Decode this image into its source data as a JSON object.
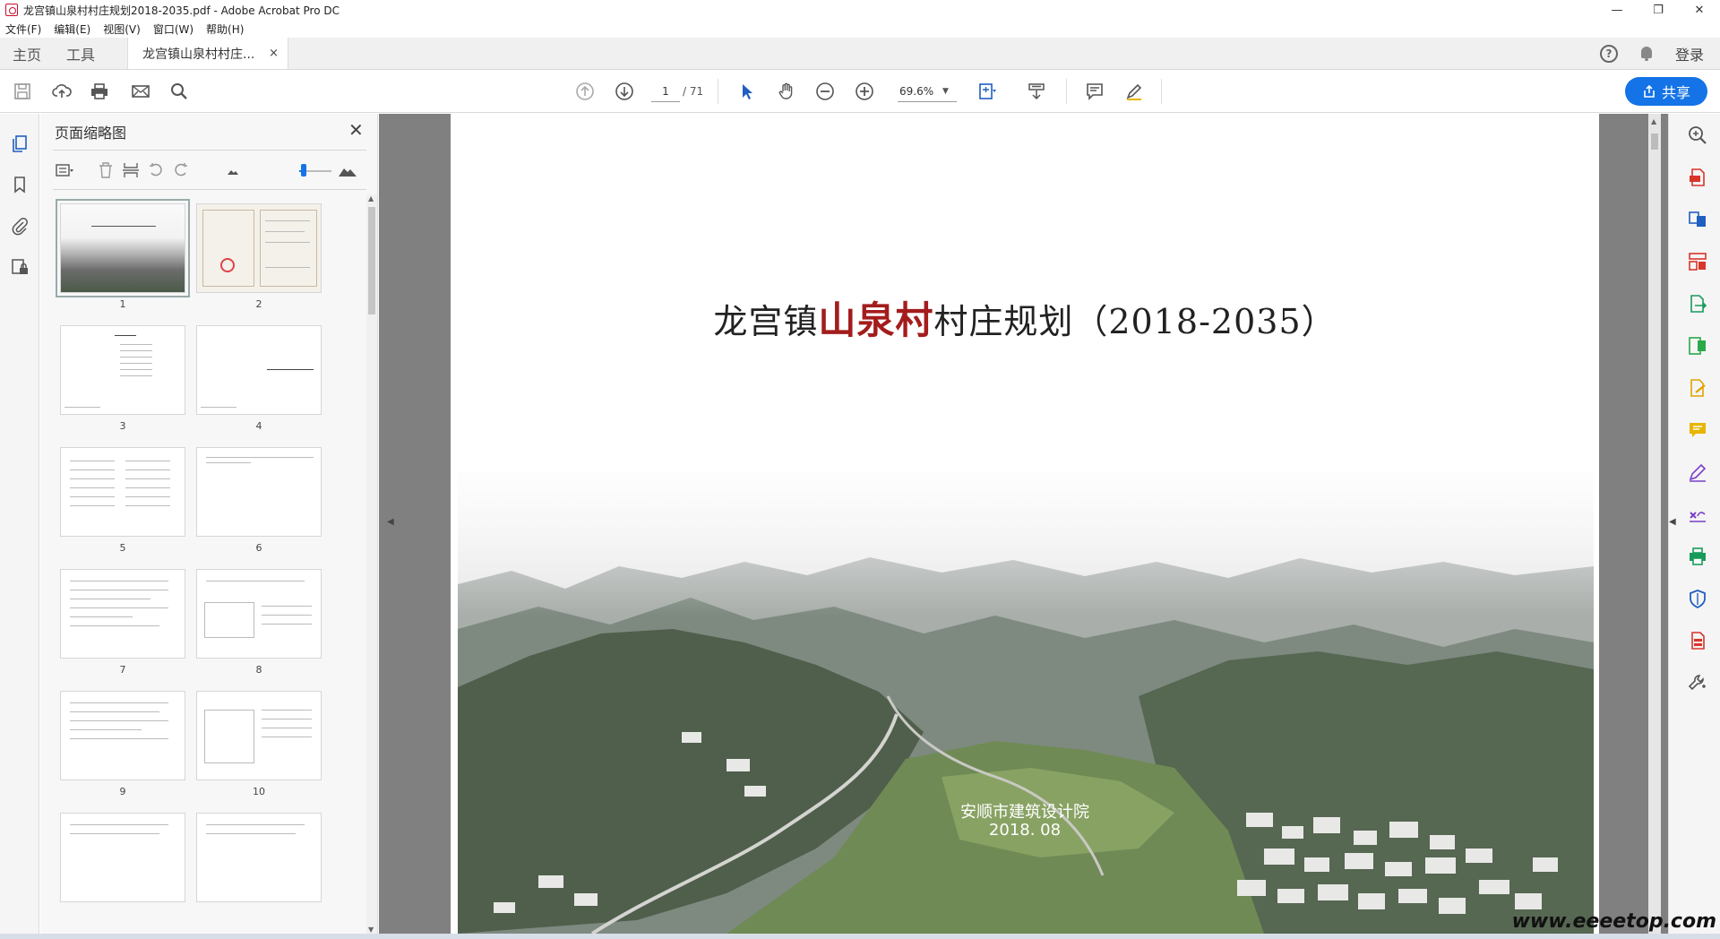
{
  "window": {
    "title": "龙宫镇山泉村村庄规划2018-2035.pdf - Adobe Acrobat Pro DC",
    "minimize": "—",
    "restore": "❐",
    "close": "✕"
  },
  "menu": [
    "文件(F)",
    "编辑(E)",
    "视图(V)",
    "窗口(W)",
    "帮助(H)"
  ],
  "tabs": {
    "home": "主页",
    "tools": "工具",
    "document": "龙宫镇山泉村村庄...",
    "close": "×",
    "help": "?",
    "login": "登录"
  },
  "toolbar": {
    "page_current": "1",
    "page_total": "/ 71",
    "zoom": "69.6%",
    "share": "共享"
  },
  "thumbnail_panel": {
    "title": "页面缩略图",
    "close": "✕",
    "pages": [
      "1",
      "2",
      "3",
      "4",
      "5",
      "6",
      "7",
      "8",
      "9",
      "10"
    ],
    "selected_page": "1"
  },
  "document": {
    "title_prefix": "龙宫镇",
    "title_highlight": "山泉村",
    "title_suffix": "村庄规划（2018-2035）",
    "org": "安顺市建筑设计院",
    "date": "2018. 08"
  },
  "watermark": "www.eeeetop.com",
  "colors": {
    "accent": "#1473e6",
    "title_red": "#a31d1d"
  }
}
